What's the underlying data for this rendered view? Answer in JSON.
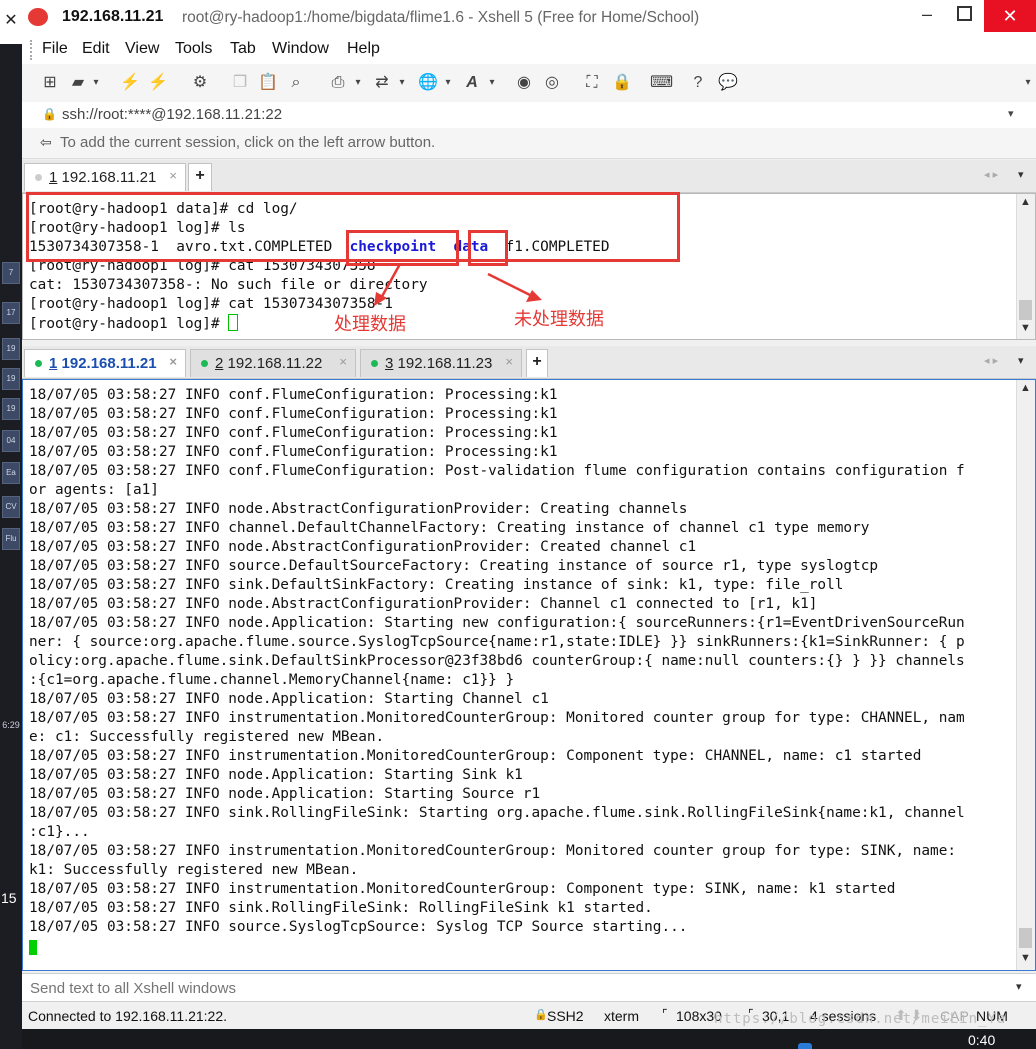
{
  "window": {
    "host": "192.168.11.21",
    "title": "root@ry-hadoop1:/home/bigdata/flime1.6 - Xshell 5 (Free for Home/School)"
  },
  "menu": [
    "File",
    "Edit",
    "View",
    "Tools",
    "Tab",
    "Window",
    "Help"
  ],
  "address": "ssh://root:****@192.168.11.21:22",
  "hint": "To add the current session, click on the left arrow button.",
  "top_tab": {
    "num": "1",
    "host": "192.168.11.21"
  },
  "top_terminal": {
    "lines": [
      "[root@ry-hadoop1 data]# cd log/",
      "[root@ry-hadoop1 log]# ls",
      "1530734307358-1  avro.txt.COMPLETED",
      "[root@ry-hadoop1 log]# cat 1530734307358",
      "cat: 1530734307358-: No such file or directory",
      "[root@ry-hadoop1 log]# cat 1530734307358-1",
      "[root@ry-hadoop1 log]# "
    ],
    "ls_checkpoint": "checkpoint",
    "ls_data": "data",
    "ls_f1": "f1.COMPLETED"
  },
  "annotations": {
    "processed": "处理数据",
    "unprocessed": "未处理数据"
  },
  "bottom_tabs": [
    {
      "num": "1",
      "host": "192.168.11.21"
    },
    {
      "num": "2",
      "host": "192.168.11.22"
    },
    {
      "num": "3",
      "host": "192.168.11.23"
    }
  ],
  "log_lines": [
    "18/07/05 03:58:27 INFO conf.FlumeConfiguration: Processing:k1",
    "18/07/05 03:58:27 INFO conf.FlumeConfiguration: Processing:k1",
    "18/07/05 03:58:27 INFO conf.FlumeConfiguration: Processing:k1",
    "18/07/05 03:58:27 INFO conf.FlumeConfiguration: Processing:k1",
    "18/07/05 03:58:27 INFO conf.FlumeConfiguration: Post-validation flume configuration contains configuration f",
    "or agents: [a1]",
    "18/07/05 03:58:27 INFO node.AbstractConfigurationProvider: Creating channels",
    "18/07/05 03:58:27 INFO channel.DefaultChannelFactory: Creating instance of channel c1 type memory",
    "18/07/05 03:58:27 INFO node.AbstractConfigurationProvider: Created channel c1",
    "18/07/05 03:58:27 INFO source.DefaultSourceFactory: Creating instance of source r1, type syslogtcp",
    "18/07/05 03:58:27 INFO sink.DefaultSinkFactory: Creating instance of sink: k1, type: file_roll",
    "18/07/05 03:58:27 INFO node.AbstractConfigurationProvider: Channel c1 connected to [r1, k1]",
    "18/07/05 03:58:27 INFO node.Application: Starting new configuration:{ sourceRunners:{r1=EventDrivenSourceRun",
    "ner: { source:org.apache.flume.source.SyslogTcpSource{name:r1,state:IDLE} }} sinkRunners:{k1=SinkRunner: { p",
    "olicy:org.apache.flume.sink.DefaultSinkProcessor@23f38bd6 counterGroup:{ name:null counters:{} } }} channels",
    ":{c1=org.apache.flume.channel.MemoryChannel{name: c1}} }",
    "18/07/05 03:58:27 INFO node.Application: Starting Channel c1",
    "18/07/05 03:58:27 INFO instrumentation.MonitoredCounterGroup: Monitored counter group for type: CHANNEL, nam",
    "e: c1: Successfully registered new MBean.",
    "18/07/05 03:58:27 INFO instrumentation.MonitoredCounterGroup: Component type: CHANNEL, name: c1 started",
    "18/07/05 03:58:27 INFO node.Application: Starting Sink k1",
    "18/07/05 03:58:27 INFO node.Application: Starting Source r1",
    "18/07/05 03:58:27 INFO sink.RollingFileSink: Starting org.apache.flume.sink.RollingFileSink{name:k1, channel",
    ":c1}...",
    "18/07/05 03:58:27 INFO instrumentation.MonitoredCounterGroup: Monitored counter group for type: SINK, name:",
    "k1: Successfully registered new MBean.",
    "18/07/05 03:58:27 INFO instrumentation.MonitoredCounterGroup: Component type: SINK, name: k1 started",
    "18/07/05 03:58:27 INFO sink.RollingFileSink: RollingFileSink k1 started.",
    "18/07/05 03:58:27 INFO source.SyslogTcpSource: Syslog TCP Source starting..."
  ],
  "send_placeholder": "Send text to all Xshell windows",
  "status": {
    "connected": "Connected to 192.168.11.21:22.",
    "protocol": "SSH2",
    "term": "xterm",
    "size": "108x30",
    "cursor": "30,1",
    "sessions": "4 sessions",
    "cap": "CAP",
    "num": "NUM"
  },
  "watermark": "https://blog.csdn.net/meiLin_Ya",
  "clock": "0:40",
  "desktop_text": {
    "side_num": "15",
    "side_time": "6:29"
  },
  "colors": {
    "highlight_blue": "#1a1ad6",
    "annotation_red": "#e53935",
    "tab_dot_green": "#1db954",
    "cursor_green": "#00d000"
  }
}
